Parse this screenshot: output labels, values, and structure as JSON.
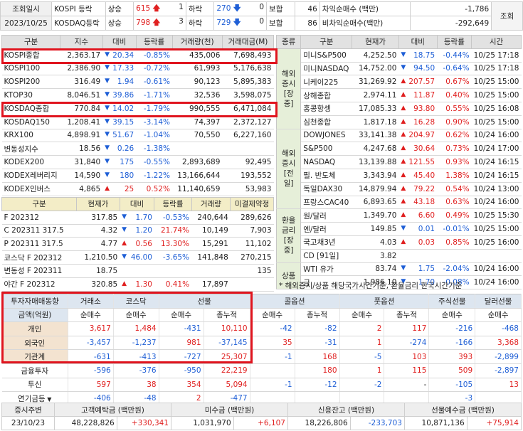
{
  "top": {
    "query_label": "조회일시",
    "date": "2023/10/25",
    "kospi_label": "KOSPI 등락",
    "kosdaq_label": "KOSDAQ등락",
    "rise_label": "상승",
    "fall_label": "하락",
    "flat_label": "보합",
    "kospi_rise": "615",
    "kospi_uplimit": "1",
    "kospi_fall": "270",
    "kospi_downlimit": "0",
    "kospi_flat": "46",
    "kosdaq_rise": "798",
    "kosdaq_uplimit": "3",
    "kosdaq_fall": "729",
    "kosdaq_downlimit": "0",
    "kosdaq_flat": "86",
    "arb_label": "차익순매수 (백만)",
    "nonarb_label": "비차익순매수(백만)",
    "arb_value": "-1,786",
    "nonarb_value": "-292,649",
    "query_button": "조회"
  },
  "left_index": {
    "headers": [
      "구분",
      "지수",
      "대비",
      "등락률",
      "거래량(천)",
      "거래대금(M)"
    ],
    "rows": [
      {
        "name": "KOSPI종합",
        "val": "2,363.17",
        "dir": "dn",
        "chg": "20.34",
        "rate": "-0.85%",
        "vol": "435,006",
        "amt": "7,698,493"
      },
      {
        "name": "KOSPI100",
        "val": "2,386.90",
        "dir": "dn",
        "chg": "17.33",
        "rate": "-0.72%",
        "vol": "61,993",
        "amt": "5,176,638"
      },
      {
        "name": "KOSPI200",
        "val": "316.49",
        "dir": "dn",
        "chg": "1.94",
        "rate": "-0.61%",
        "vol": "90,123",
        "amt": "5,895,383"
      },
      {
        "name": "KTOP30",
        "val": "8,046.51",
        "dir": "dn",
        "chg": "39.86",
        "rate": "-1.71%",
        "vol": "32,536",
        "amt": "3,598,075"
      },
      {
        "name": "KOSDAQ종합",
        "val": "770.84",
        "dir": "dn",
        "chg": "14.02",
        "rate": "-1.79%",
        "vol": "990,555",
        "amt": "6,471,084"
      },
      {
        "name": "KOSDAQ150",
        "val": "1,208.41",
        "dir": "dn",
        "chg": "39.15",
        "rate": "-3.14%",
        "vol": "74,397",
        "amt": "2,372,127"
      },
      {
        "name": "KRX100",
        "val": "4,898.91",
        "dir": "dn",
        "chg": "51.67",
        "rate": "-1.04%",
        "vol": "70,550",
        "amt": "6,227,160"
      },
      {
        "name": "변동성지수",
        "val": "18.56",
        "dir": "dn",
        "chg": "0.26",
        "rate": "-1.38%",
        "vol": "",
        "amt": ""
      },
      {
        "name": "KODEX200",
        "val": "31,840",
        "dir": "dn",
        "chg": "175",
        "rate": "-0.55%",
        "vol": "2,893,689",
        "amt": "92,495"
      },
      {
        "name": "KODEX레버리지",
        "val": "14,590",
        "dir": "dn",
        "chg": "180",
        "rate": "-1.22%",
        "vol": "13,166,644",
        "amt": "193,552"
      },
      {
        "name": "KODEX인버스",
        "val": "4,865",
        "dir": "up",
        "chg": "25",
        "rate": "0.52%",
        "vol": "11,140,659",
        "amt": "53,983"
      }
    ]
  },
  "futures": {
    "headers": [
      "구분",
      "현재가",
      "대비",
      "등락률",
      "거래량",
      "미결제약정"
    ],
    "rows": [
      {
        "name": "F 202312",
        "val": "317.85",
        "dir": "dn",
        "chg": "1.70",
        "rate": "-0.53%",
        "vol": "240,644",
        "oi": "289,626"
      },
      {
        "name": "C 202311 317.5",
        "val": "4.32",
        "dir": "dn",
        "chg": "1.20",
        "rate": "21.74%",
        "vol": "10,149",
        "oi": "7,903"
      },
      {
        "name": "P 202311 317.5",
        "val": "4.77",
        "dir": "up",
        "chg": "0.56",
        "rate": "13.30%",
        "vol": "15,291",
        "oi": "11,102"
      },
      {
        "name": "코스닥 F 202312",
        "val": "1,210.50",
        "dir": "dn",
        "chg": "46.00",
        "rate": "-3.65%",
        "vol": "141,848",
        "oi": "270,215"
      },
      {
        "name": "변동성 F 202311",
        "val": "18.75",
        "dir": "",
        "chg": "",
        "rate": "",
        "vol": "",
        "oi": "135"
      },
      {
        "name": "야간 F 202312",
        "val": "320.85",
        "dir": "up",
        "chg": "1.30",
        "rate": "0.41%",
        "vol": "17,897",
        "oi": ""
      }
    ]
  },
  "right": {
    "headers": [
      "종류",
      "구분",
      "현재가",
      "대비",
      "등락률",
      "시간"
    ],
    "groups": [
      {
        "label": "해외\n증시\n[장중]",
        "rows": [
          {
            "name": "미니S&P500",
            "val": "4,252.50",
            "dir": "dn",
            "chg": "18.75",
            "rate": "-0.44%",
            "time": "10/25  17:18"
          },
          {
            "name": "미니NASDAQ",
            "val": "14,752.00",
            "dir": "dn",
            "chg": "94.50",
            "rate": "-0.64%",
            "time": "10/25  17:18"
          },
          {
            "name": "니케이225",
            "val": "31,269.92",
            "dir": "up",
            "chg": "207.57",
            "rate": "0.67%",
            "time": "10/25  15:00"
          },
          {
            "name": "상해종합",
            "val": "2,974.11",
            "dir": "up",
            "chg": "11.87",
            "rate": "0.40%",
            "time": "10/25  15:00"
          },
          {
            "name": "홍콩항셍",
            "val": "17,085.33",
            "dir": "up",
            "chg": "93.80",
            "rate": "0.55%",
            "time": "10/25  16:08"
          },
          {
            "name": "심천종합",
            "val": "1,817.18",
            "dir": "up",
            "chg": "16.28",
            "rate": "0.90%",
            "time": "10/25  15:00"
          }
        ]
      },
      {
        "label": "해외\n증시\n[전일]",
        "rows": [
          {
            "name": "DOWJONES",
            "val": "33,141.38",
            "dir": "up",
            "chg": "204.97",
            "rate": "0.62%",
            "time": "10/24  16:00"
          },
          {
            "name": "S&P500",
            "val": "4,247.68",
            "dir": "up",
            "chg": "30.64",
            "rate": "0.73%",
            "time": "10/24  17:00"
          },
          {
            "name": "NASDAQ",
            "val": "13,139.88",
            "dir": "up",
            "chg": "121.55",
            "rate": "0.93%",
            "time": "10/24  16:15"
          },
          {
            "name": "필. 반도체",
            "val": "3,343.94",
            "dir": "up",
            "chg": "45.40",
            "rate": "1.38%",
            "time": "10/24  16:15"
          },
          {
            "name": "독일DAX30",
            "val": "14,879.94",
            "dir": "up",
            "chg": "79.22",
            "rate": "0.54%",
            "time": "10/24  13:00"
          },
          {
            "name": "프랑스CAC40",
            "val": "6,893.65",
            "dir": "up",
            "chg": "43.18",
            "rate": "0.63%",
            "time": "10/24  16:00"
          }
        ]
      },
      {
        "label": "환율\n금리\n[장중]",
        "rows": [
          {
            "name": "원/달러",
            "val": "1,349.70",
            "dir": "up",
            "chg": "6.60",
            "rate": "0.49%",
            "time": "10/25  15:30"
          },
          {
            "name": "엔/달러",
            "val": "149.85",
            "dir": "dn",
            "chg": "0.01",
            "rate": "-0.01%",
            "time": "10/25  15:00"
          },
          {
            "name": "국고채3년",
            "val": "4.03",
            "dir": "up",
            "chg": "0.03",
            "rate": "0.85%",
            "time": "10/25  16:00"
          },
          {
            "name": "CD [91일]",
            "val": "3.82",
            "dir": "",
            "chg": "",
            "rate": "",
            "time": ""
          }
        ]
      },
      {
        "label": "상품",
        "rows": [
          {
            "name": "WTI 유가",
            "val": "83.74",
            "dir": "dn",
            "chg": "1.75",
            "rate": "-2.04%",
            "time": "10/24  16:00"
          },
          {
            "name": "금",
            "val": "1,986.10",
            "dir": "dn",
            "chg": "1.70",
            "rate": "-0.08%",
            "time": "10/24  16:00"
          }
        ]
      }
    ],
    "note": "* 해외증시/상품 해당국가시간기준, 환율금리 한국시간기준"
  },
  "investor": {
    "title": "투자자매매동향",
    "unit_label": "금액(억원)",
    "groups": [
      "거래소",
      "코스닥",
      "선물",
      "콜옵션",
      "풋옵션",
      "주식선물",
      "달러선물"
    ],
    "sub": [
      "순매수",
      "순매수",
      "순매수",
      "총누적",
      "순매수",
      "총누적",
      "순매수",
      "총누적",
      "순매수",
      "순매수"
    ],
    "rows": [
      {
        "name": "개인",
        "cells": [
          "3,617",
          "1,484",
          "-431",
          "10,110",
          "-42",
          "-82",
          "2",
          "117",
          "-216",
          "-468"
        ],
        "dirs": [
          "up",
          "up",
          "dn",
          "up",
          "dn",
          "dn",
          "up",
          "up",
          "dn",
          "dn"
        ]
      },
      {
        "name": "외국인",
        "cells": [
          "-3,457",
          "-1,237",
          "981",
          "-37,145",
          "35",
          "-31",
          "1",
          "-274",
          "-166",
          "3,368"
        ],
        "dirs": [
          "dn",
          "dn",
          "up",
          "dn",
          "up",
          "dn",
          "up",
          "dn",
          "dn",
          "up"
        ]
      },
      {
        "name": "기관계",
        "cells": [
          "-631",
          "-413",
          "-727",
          "25,307",
          "-1",
          "168",
          "-5",
          "103",
          "393",
          "-2,899"
        ],
        "dirs": [
          "dn",
          "dn",
          "dn",
          "up",
          "dn",
          "up",
          "dn",
          "up",
          "up",
          "dn"
        ]
      },
      {
        "name": "금융투자",
        "cells": [
          "-596",
          "-376",
          "-950",
          "22,219",
          "",
          "180",
          "1",
          "115",
          "509",
          "-2,897"
        ],
        "dirs": [
          "dn",
          "dn",
          "dn",
          "up",
          "",
          "up",
          "up",
          "up",
          "up",
          "dn"
        ]
      },
      {
        "name": "투신",
        "cells": [
          "597",
          "38",
          "354",
          "5,094",
          "-1",
          "-12",
          "-2",
          "-",
          "-105",
          "13"
        ],
        "dirs": [
          "up",
          "up",
          "up",
          "up",
          "dn",
          "dn",
          "dn",
          "",
          "dn",
          "up"
        ]
      },
      {
        "name": "연기금등",
        "cells": [
          "-406",
          "-48",
          "2",
          "-477",
          "",
          "",
          "",
          "",
          "-3",
          ""
        ],
        "dirs": [
          "dn",
          "dn",
          "up",
          "dn",
          "",
          "",
          "",
          "",
          "dn",
          ""
        ]
      }
    ]
  },
  "bottom": {
    "headers": [
      "증시주변",
      "고객예탁금 (백만원)",
      "미수금 (백만원)",
      "신용잔고 (백만원)",
      "선물예수금 (백만원)"
    ],
    "date": "23/10/23",
    "deposit": "48,228,826",
    "deposit_chg": "+330,341",
    "unpaid": "1,031,970",
    "unpaid_chg": "+6,107",
    "credit": "18,226,806",
    "credit_chg": "-233,703",
    "fut_deposit": "10,871,136",
    "fut_deposit_chg": "+75,914"
  }
}
